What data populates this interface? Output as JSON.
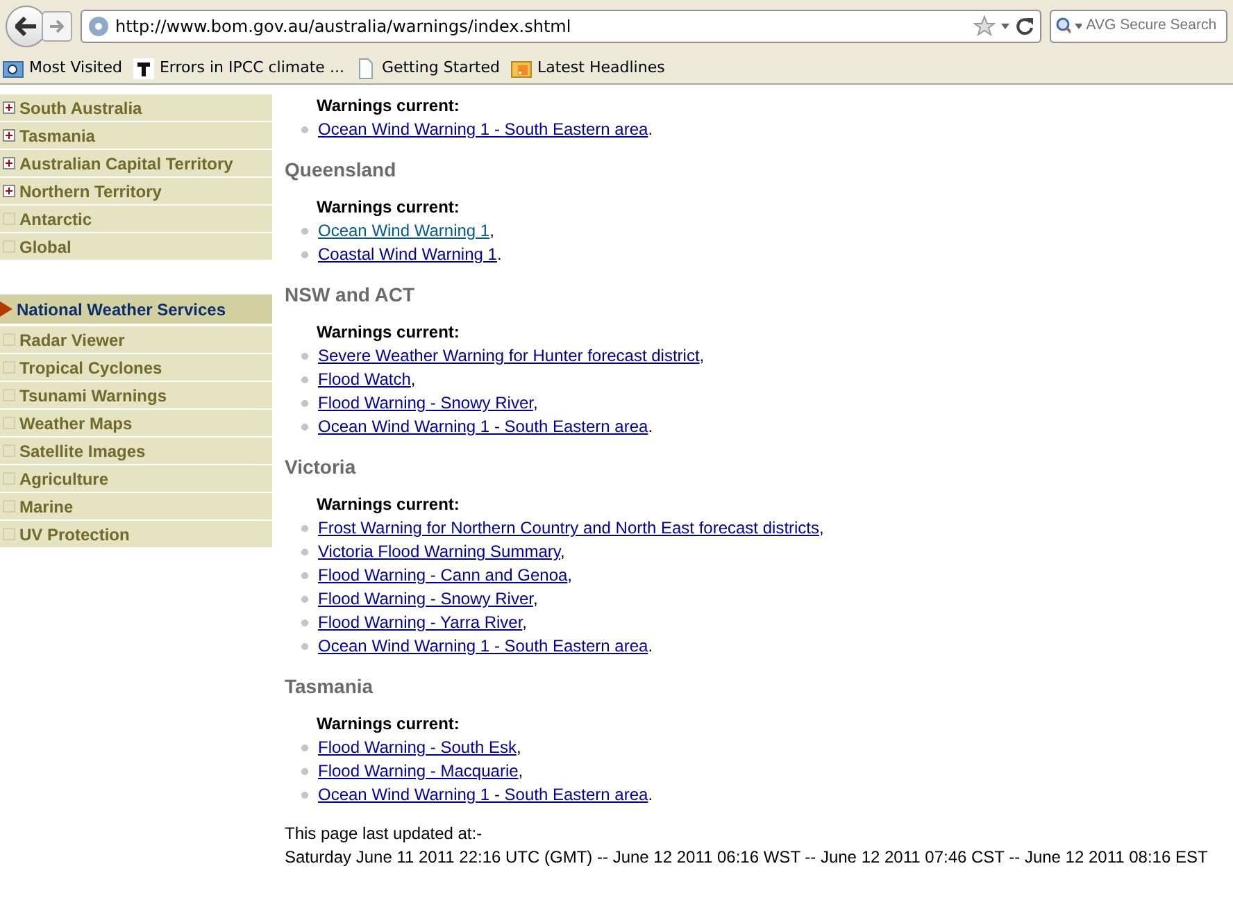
{
  "browser": {
    "url": "http://www.bom.gov.au/australia/warnings/index.shtml",
    "search": {
      "placeholder": "AVG Secure Search"
    },
    "bookmarks": [
      {
        "kind": "folder",
        "label": "Most Visited"
      },
      {
        "kind": "site",
        "label": "Errors in IPCC climate ..."
      },
      {
        "kind": "page",
        "label": "Getting Started"
      },
      {
        "kind": "feed",
        "label": "Latest Headlines"
      }
    ]
  },
  "sidebar": {
    "groups": [
      {
        "items": [
          {
            "kind": "expand",
            "label": "South Australia",
            "selected": false
          },
          {
            "kind": "expand",
            "label": "Tasmania",
            "selected": false
          },
          {
            "kind": "expand",
            "label": "Australian Capital Territory",
            "selected": false
          },
          {
            "kind": "expand",
            "label": "Northern Territory",
            "selected": false
          },
          {
            "kind": "plain",
            "label": "Antarctic",
            "selected": false
          },
          {
            "kind": "plain",
            "label": "Global",
            "selected": false
          }
        ]
      },
      {
        "items": [
          {
            "kind": "section",
            "label": "National Weather Services",
            "selected": true
          },
          {
            "kind": "plain",
            "label": "Radar Viewer",
            "selected": false
          },
          {
            "kind": "plain",
            "label": "Tropical Cyclones",
            "selected": false
          },
          {
            "kind": "plain",
            "label": "Tsunami Warnings",
            "selected": false
          },
          {
            "kind": "plain",
            "label": "Weather Maps",
            "selected": false
          },
          {
            "kind": "plain",
            "label": "Satellite Images",
            "selected": false
          },
          {
            "kind": "plain",
            "label": "Agriculture",
            "selected": false
          },
          {
            "kind": "plain",
            "label": "Marine",
            "selected": false
          },
          {
            "kind": "plain",
            "label": "UV Protection",
            "selected": false
          }
        ]
      }
    ]
  },
  "sections": [
    {
      "subheading": "Warnings current:",
      "warnings": [
        {
          "link": "Ocean Wind Warning 1 - South Eastern area",
          "punctuation": ".",
          "visited": false
        }
      ]
    },
    {
      "heading": "Queensland",
      "subheading": "Warnings current:",
      "warnings": [
        {
          "link": "Ocean Wind Warning 1",
          "punctuation": ",",
          "visited": true
        },
        {
          "link": "Coastal Wind Warning 1",
          "punctuation": ".",
          "visited": false
        }
      ]
    },
    {
      "heading": "NSW and ACT",
      "subheading": "Warnings current:",
      "warnings": [
        {
          "link": "Severe Weather Warning for Hunter forecast district",
          "punctuation": ",",
          "visited": false
        },
        {
          "link": "Flood Watch",
          "punctuation": ",",
          "visited": false
        },
        {
          "link": "Flood Warning - Snowy River",
          "punctuation": ",",
          "visited": false
        },
        {
          "link": "Ocean Wind Warning 1 - South Eastern area",
          "punctuation": ".",
          "visited": false
        }
      ]
    },
    {
      "heading": "Victoria",
      "subheading": "Warnings current:",
      "warnings": [
        {
          "link": "Frost Warning for Northern Country and North East forecast districts",
          "punctuation": ",",
          "visited": false
        },
        {
          "link": "Victoria Flood Warning Summary",
          "punctuation": ",",
          "visited": false
        },
        {
          "link": "Flood Warning - Cann and Genoa",
          "punctuation": ",",
          "visited": false
        },
        {
          "link": "Flood Warning - Snowy River",
          "punctuation": ",",
          "visited": false
        },
        {
          "link": "Flood Warning - Yarra River",
          "punctuation": ",",
          "visited": false
        },
        {
          "link": "Ocean Wind Warning 1 - South Eastern area",
          "punctuation": ".",
          "visited": false
        }
      ]
    },
    {
      "heading": "Tasmania",
      "subheading": "Warnings current:",
      "warnings": [
        {
          "link": "Flood Warning - South Esk",
          "punctuation": ",",
          "visited": false
        },
        {
          "link": "Flood Warning - Macquarie",
          "punctuation": ",",
          "visited": false
        },
        {
          "link": "Ocean Wind Warning 1 - South Eastern area",
          "punctuation": ".",
          "visited": false
        }
      ]
    }
  ],
  "footer": {
    "label": "This page last updated at:-",
    "timestamp": "Saturday June 11 2011 22:16 UTC (GMT) -- June 12 2011 06:16 WST -- June 12 2011 07:46 CST -- June 12 2011 08:16 EST"
  }
}
